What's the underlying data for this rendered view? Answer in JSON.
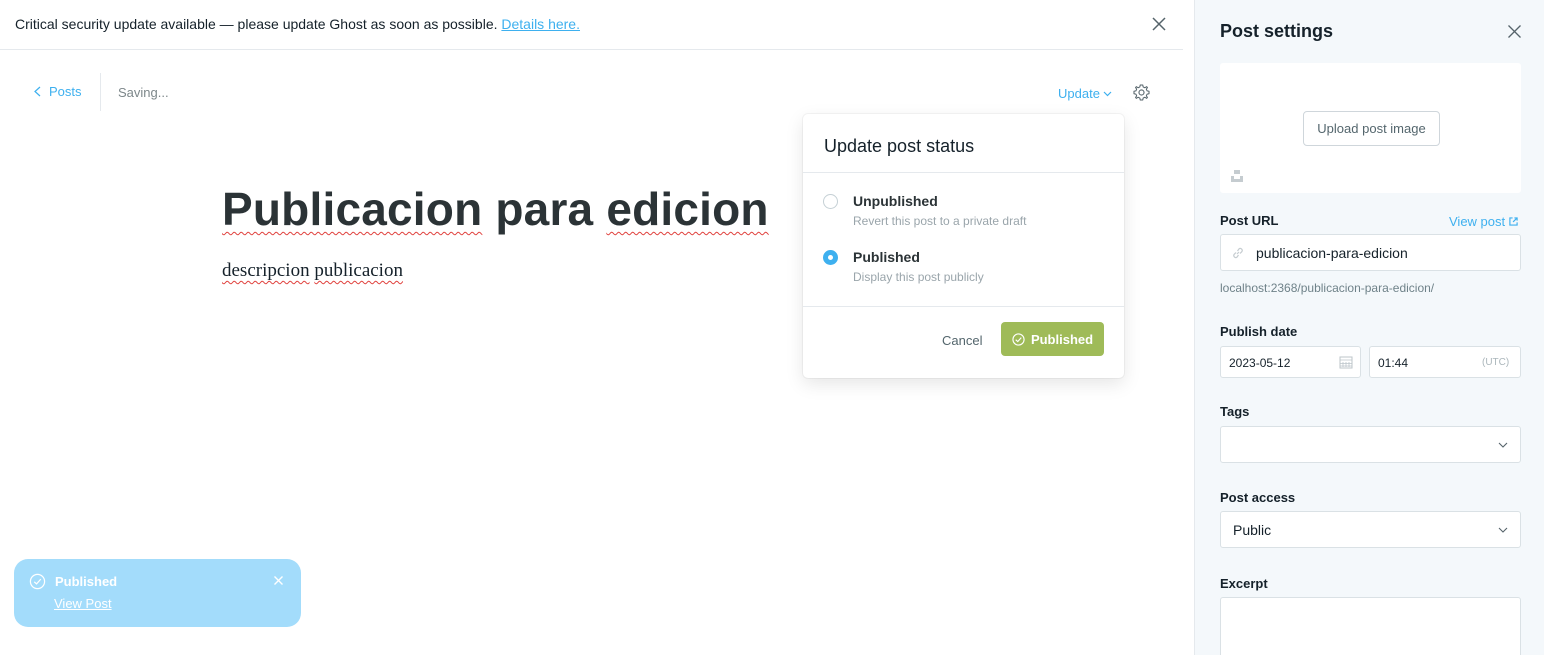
{
  "banner": {
    "message": "Critical security update available — please update Ghost as soon as possible.",
    "link_label": "Details here."
  },
  "toolbar": {
    "back_label": "Posts",
    "status": "Saving...",
    "update_label": "Update"
  },
  "post": {
    "title_words": [
      "Publicacion",
      "para",
      "edicion"
    ],
    "body_words": [
      "descripcion",
      "publicacion"
    ]
  },
  "popover": {
    "title": "Update post status",
    "options": [
      {
        "label": "Unpublished",
        "description": "Revert this post to a private draft",
        "checked": false
      },
      {
        "label": "Published",
        "description": "Display this post publicly",
        "checked": true
      }
    ],
    "cancel_label": "Cancel",
    "confirm_label": "Published",
    "confirm_color": "#9fbb58"
  },
  "toast": {
    "title": "Published",
    "link_label": "View Post",
    "color": "#a3dcfb"
  },
  "sidebar": {
    "title": "Post settings",
    "upload_label": "Upload post image",
    "post_url_label": "Post URL",
    "view_post_label": "View post",
    "url_slug": "publicacion-para-edicion",
    "url_preview": "localhost:2368/publicacion-para-edicion/",
    "publish_date_label": "Publish date",
    "date": "2023-05-12",
    "time": "01:44",
    "timezone": "(UTC)",
    "tags_label": "Tags",
    "tags_value": "",
    "access_label": "Post access",
    "access_value": "Public",
    "excerpt_label": "Excerpt"
  },
  "colors": {
    "accent": "#3eb0ef",
    "spellcheck": "#e0403c"
  }
}
